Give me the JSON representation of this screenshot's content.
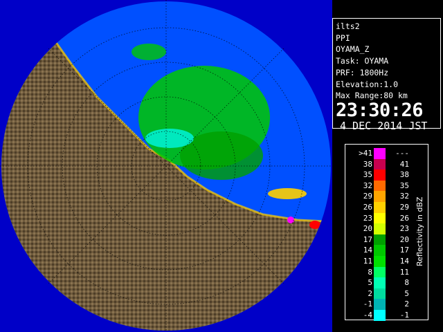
{
  "panel": {
    "station": "ilts2",
    "scan_type": "PPI",
    "product": "OYAMA_Z",
    "task": "Task: OYAMA",
    "prf": "PRF: 1800Hz",
    "elevation": "Elevation:1.0",
    "max_range": "Max Range:80 km",
    "time": "23:30:26",
    "date": "4 DEC 2014 JST"
  },
  "legend": {
    "unit_label": "Reflectivity in dBZ",
    "rows": [
      {
        "lo": ">41",
        "hi": "---",
        "color": "#ff00ff"
      },
      {
        "lo": "38",
        "hi": "41",
        "color": "#c8004f"
      },
      {
        "lo": "35",
        "hi": "38",
        "color": "#ff0000"
      },
      {
        "lo": "32",
        "hi": "35",
        "color": "#ff6a00"
      },
      {
        "lo": "29",
        "hi": "32",
        "color": "#ffa500"
      },
      {
        "lo": "26",
        "hi": "29",
        "color": "#ffd000"
      },
      {
        "lo": "23",
        "hi": "26",
        "color": "#ffff00"
      },
      {
        "lo": "20",
        "hi": "23",
        "color": "#d2ff00"
      },
      {
        "lo": "17",
        "hi": "20",
        "color": "#00a000"
      },
      {
        "lo": "14",
        "hi": "17",
        "color": "#00c800"
      },
      {
        "lo": "11",
        "hi": "14",
        "color": "#00e000"
      },
      {
        "lo": "8",
        "hi": "11",
        "color": "#00ff64"
      },
      {
        "lo": "5",
        "hi": "8",
        "color": "#00ffb4"
      },
      {
        "lo": "2",
        "hi": "5",
        "color": "#00dca0"
      },
      {
        "lo": "-1",
        "hi": "2",
        "color": "#00b4b4"
      },
      {
        "lo": "-4",
        "hi": "-1",
        "color": "#00ffff"
      }
    ]
  },
  "map": {
    "sea_color": "#0050ff",
    "land_color": "#6e5a3c",
    "background_color": "#0000c8"
  }
}
